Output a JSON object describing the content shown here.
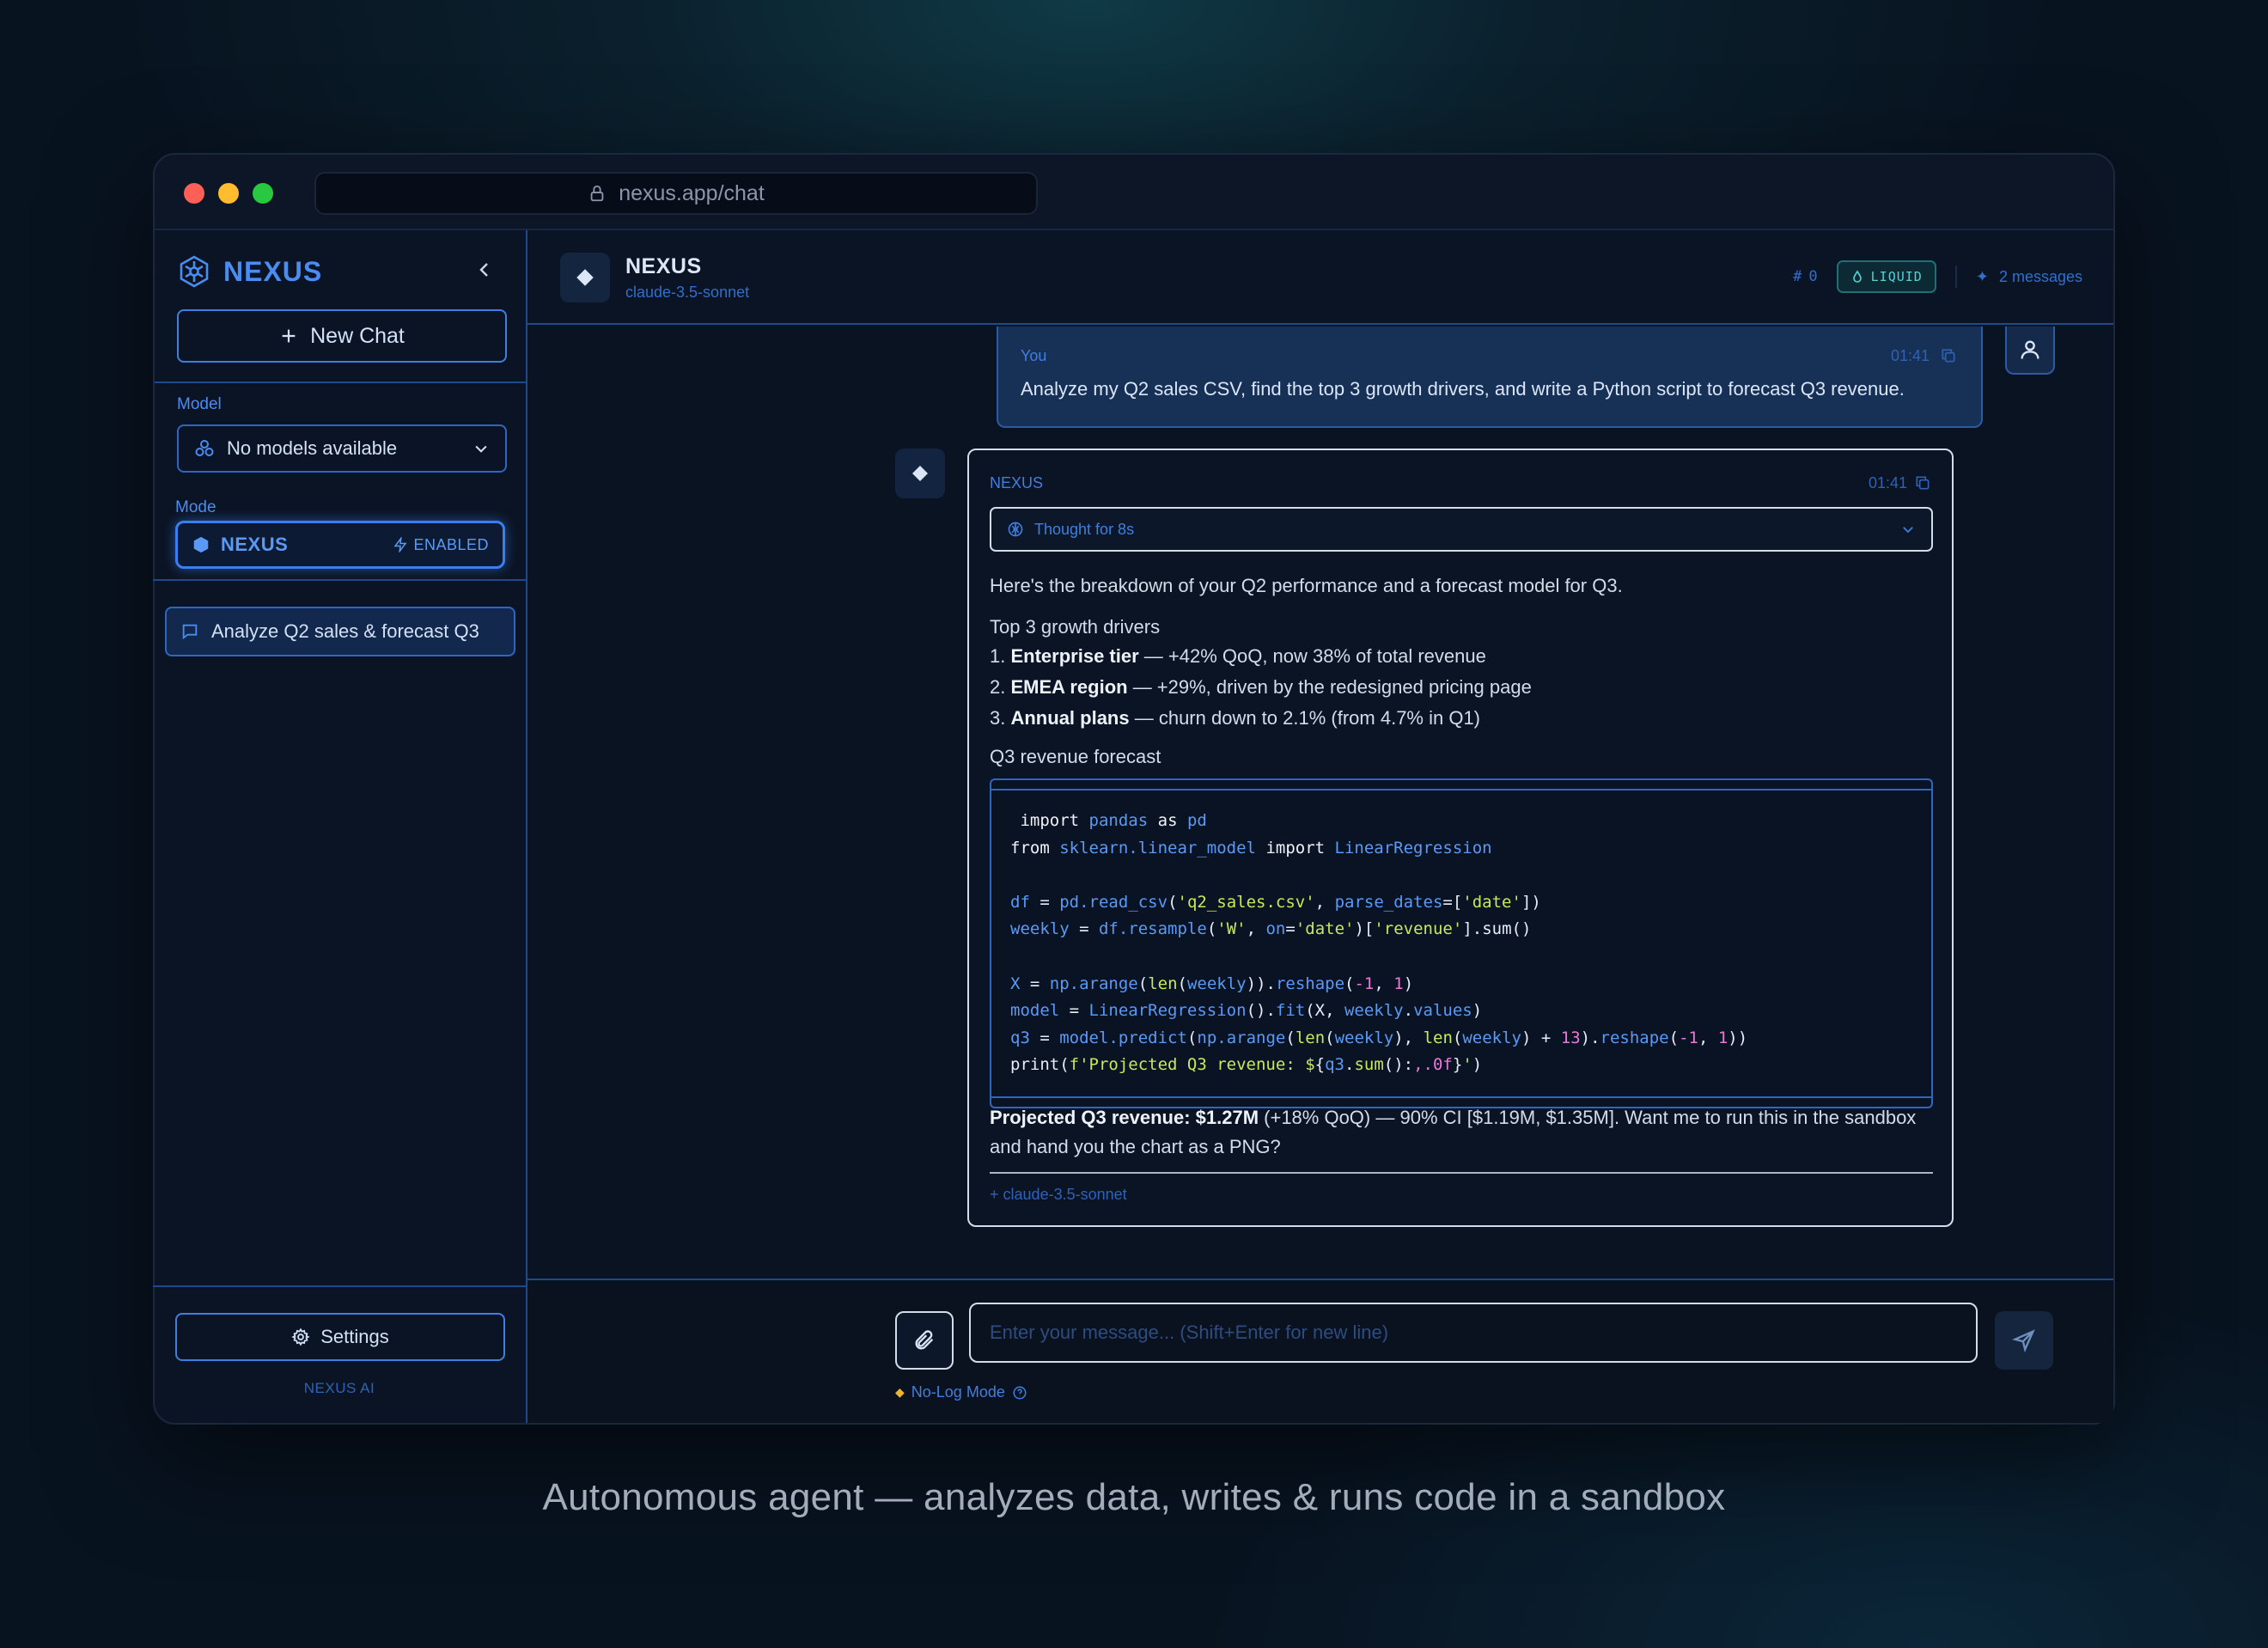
{
  "browser": {
    "url": "nexus.app/chat"
  },
  "sidebar": {
    "brand": "NEXUS",
    "new_chat_label": "New Chat",
    "model_label": "Model",
    "model_value": "No models available",
    "mode_label": "Mode",
    "mode_name": "NEXUS",
    "mode_status": "ENABLED",
    "conversations": [
      {
        "title": "Analyze Q2 sales & forecast Q3"
      }
    ],
    "settings_label": "Settings",
    "footer": "NEXUS AI"
  },
  "header": {
    "title": "NEXUS",
    "model": "claude-3.5-sonnet",
    "count": "0",
    "badge": "LIQUID",
    "messages": "2 messages"
  },
  "user_message": {
    "sender": "You",
    "time": "01:41",
    "text": "Analyze my Q2 sales CSV, find the top 3 growth drivers, and write a Python script to forecast Q3 revenue."
  },
  "assistant_message": {
    "sender": "NEXUS",
    "time": "01:41",
    "thought": "Thought for 8s",
    "intro": "Here's the breakdown of your Q2 performance and a forecast model for Q3.",
    "drivers_heading": "Top 3 growth drivers",
    "drivers": [
      {
        "num": "1.",
        "bold": "Enterprise tier",
        "rest": " — +42% QoQ, now 38% of total revenue"
      },
      {
        "num": "2.",
        "bold": "EMEA region",
        "rest": " — +29%, driven by the redesigned pricing page"
      },
      {
        "num": "3.",
        "bold": "Annual plans",
        "rest": " — churn down to 2.1% (from 4.7% in Q1)"
      }
    ],
    "forecast_heading": "Q3 revenue forecast",
    "code": {
      "l1_import": "import",
      "l1_mod": "pandas",
      "l1_as": "as",
      "l1_alias": "pd",
      "l2_from": "from",
      "l2_mod": "sklearn.linear_model",
      "l2_import": "import",
      "l2_cls": "LinearRegression",
      "l4_var": "df",
      "l4_eq": " = ",
      "l4_obj": "pd",
      "l4_fn": ".read_csv",
      "l4_open": "(",
      "l4_str": "'q2_sales.csv'",
      "l4_comma": ", ",
      "l4_kw": "parse_dates",
      "l4_eq2": "=[",
      "l4_str2": "'date'",
      "l4_close": "])",
      "l5_var": "weekly",
      "l5_eq": " = ",
      "l5_obj": "df",
      "l5_fn": ".resample",
      "l5_open": "(",
      "l5_str": "'W'",
      "l5_comma": ", ",
      "l5_kw": "on",
      "l5_eq2": "=",
      "l5_str2": "'date'",
      "l5_mid": ")[",
      "l5_str3": "'revenue'",
      "l5_end": "].sum()",
      "l7_var": "X",
      "l7_eq": " = ",
      "l7_obj": "np",
      "l7_fn": ".arange",
      "l7_open": "(",
      "l7_len": "len",
      "l7_open2": "(",
      "l7_arg": "weekly",
      "l7_close": ")).",
      "l7_fn2": "reshape",
      "l7_open3": "(",
      "l7_n1": "-1",
      "l7_comma": ", ",
      "l7_n2": "1",
      "l7_end": ")",
      "l8_var": "model",
      "l8_eq": " = ",
      "l8_cls": "LinearRegression",
      "l8_mid": "().",
      "l8_fn": "fit",
      "l8_open": "(X, ",
      "l8_arg": "weekly",
      "l8_dot": ".",
      "l8_attr": "values",
      "l8_end": ")",
      "l9_var": "q3",
      "l9_eq": " = ",
      "l9_obj": "model",
      "l9_fn": ".predict",
      "l9_open": "(",
      "l9_obj2": "np",
      "l9_fn2": ".arange",
      "l9_open2": "(",
      "l9_len": "len",
      "l9_open3": "(",
      "l9_arg": "weekly",
      "l9_mid": "), ",
      "l9_len2": "len",
      "l9_open4": "(",
      "l9_arg2": "weekly",
      "l9_plus": ") + ",
      "l9_n": "13",
      "l9_mid2": ").",
      "l9_fn3": "reshape",
      "l9_open5": "(",
      "l9_n1": "-1",
      "l9_comma": ", ",
      "l9_n2": "1",
      "l9_end": "))",
      "l10_fn": "print",
      "l10_open": "(",
      "l10_str": "f'Projected Q3 revenue: $",
      "l10_brace": "{",
      "l10_var": "q3",
      "l10_dot": ".",
      "l10_sum": "sum",
      "l10_paren": "():",
      "l10_fmt": ",.0f",
      "l10_brace2": "}",
      "l10_str2": "'",
      "l10_end": ")"
    },
    "outro_bold": "Projected Q3 revenue: $1.27M",
    "outro_rest": " (+18% QoQ) — 90% CI [$1.19M, $1.35M]. Want me to run this in the sandbox and hand you the chart as a PNG?",
    "footer_model": "claude-3.5-sonnet"
  },
  "composer": {
    "placeholder": "Enter your message... (Shift+Enter for new line)",
    "nolog": "No-Log Mode"
  },
  "caption": "Autonomous agent — analyzes data, writes & runs code in a sandbox",
  "colors": {
    "accent": "#3f7fe0",
    "liquid": "#56d0d8",
    "background": "#0a1220"
  }
}
